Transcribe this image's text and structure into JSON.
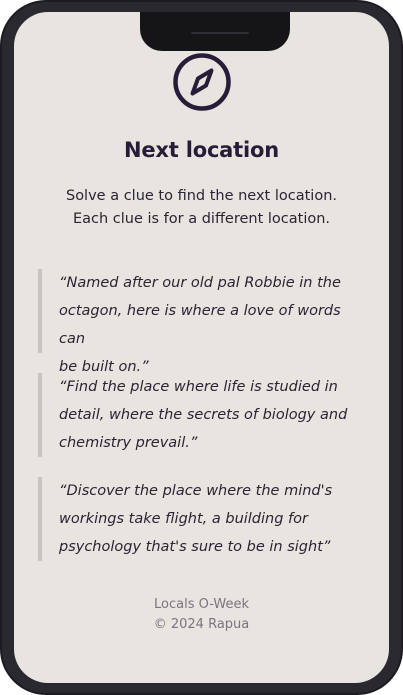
{
  "page": {
    "icon": "compass-icon",
    "title": "Next location",
    "subtitle_line1": "Solve a clue to find the next location.",
    "subtitle_line2": "Each clue is for a different location."
  },
  "clues": [
    {
      "line1": "“Named after our old pal Robbie in the",
      "line2": "octagon, here is where a love of words can",
      "line3": "be built on.”"
    },
    {
      "line1": "“Find the place where life is studied in",
      "line2": "detail, where the secrets of biology and",
      "line3": "chemistry prevail.”"
    },
    {
      "line1": "“Discover the place where the mind's",
      "line2": "workings take flight, a building for",
      "line3": "psychology that's sure to be in sight”"
    }
  ],
  "footer": {
    "event": "Locals O-Week",
    "copyright": "© 2024 Rapua"
  },
  "colors": {
    "background": "#e8e4e0",
    "text": "#261d38",
    "quote_bar": "#c7c3bf",
    "footer_text": "#7a7580"
  }
}
